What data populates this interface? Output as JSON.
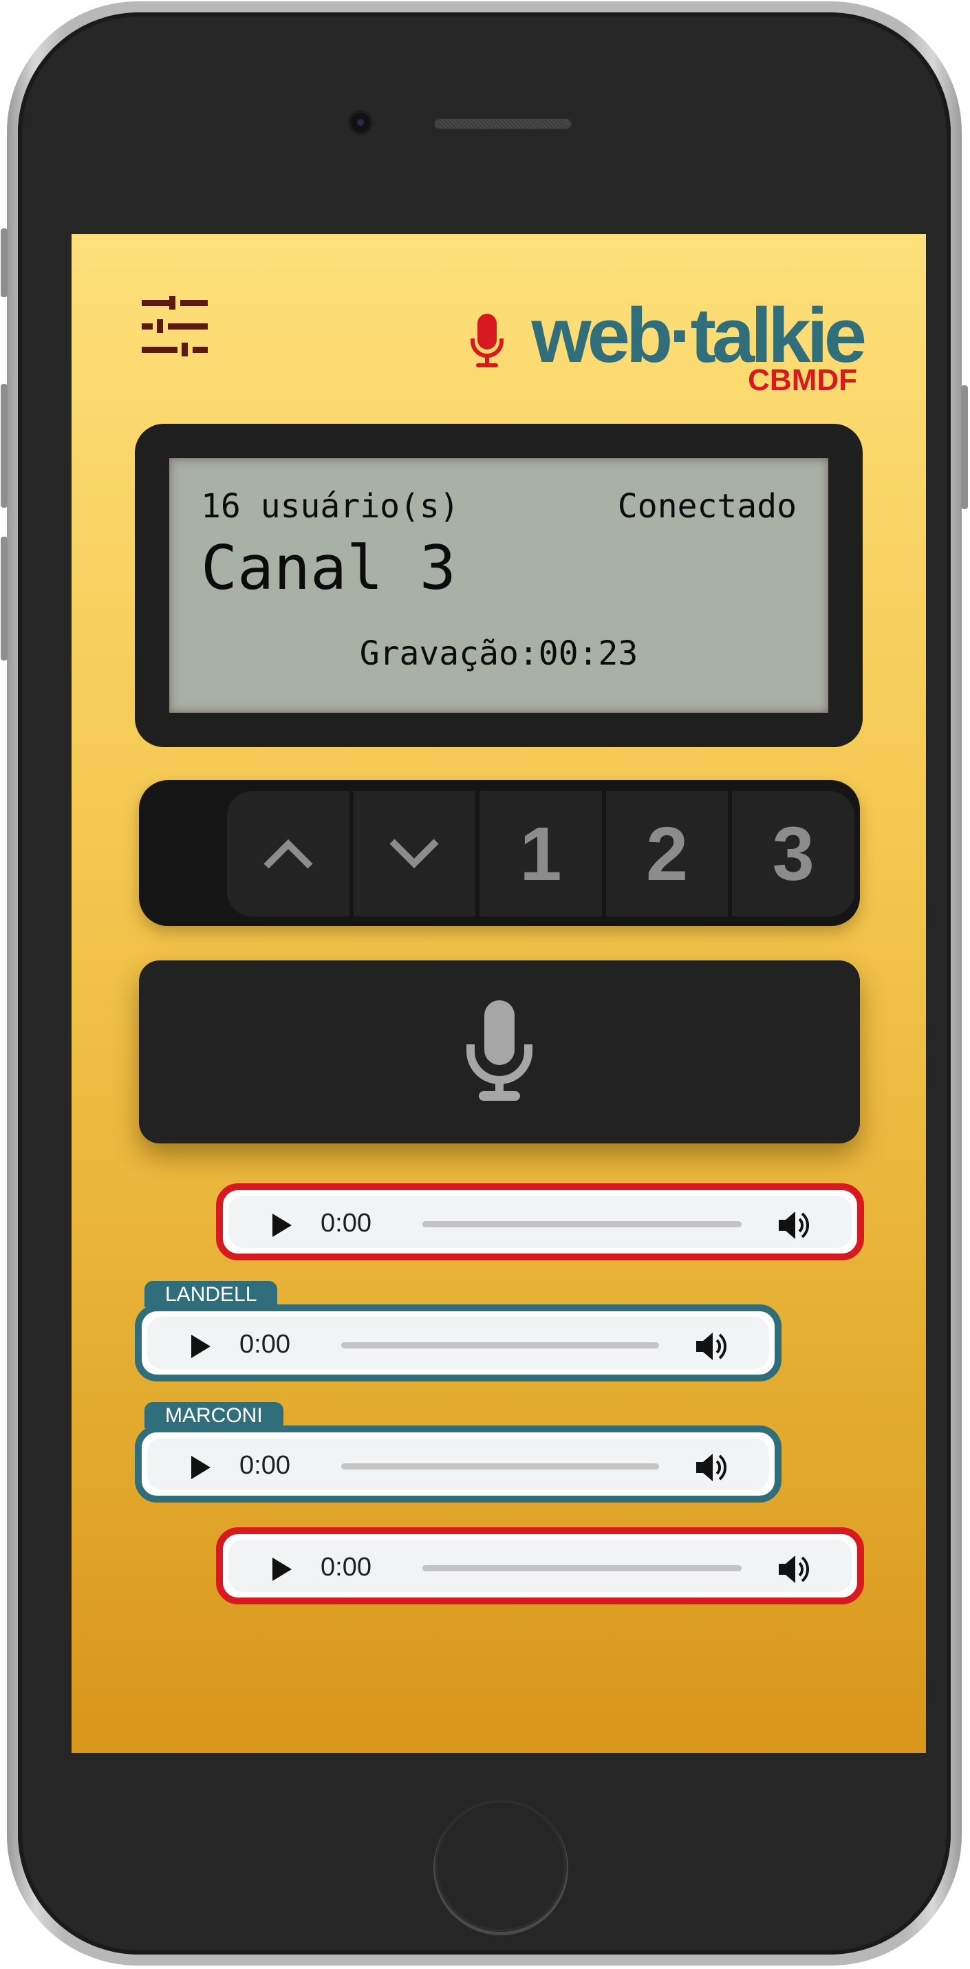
{
  "app": {
    "logo_text": "web·talkie",
    "logo_subtitle": "CBMDF",
    "brand_colors": {
      "teal": "#2f6e7a",
      "red": "#d71920",
      "yellow": "#f3c44b"
    }
  },
  "header": {
    "settings_icon": "sliders-icon"
  },
  "display": {
    "users": "16 usuário(s)",
    "status": "Conectado",
    "channel": "Canal 3",
    "recording": "Gravação:00:23"
  },
  "keypad": {
    "up_icon": "chevron-up-icon",
    "down_icon": "chevron-down-icon",
    "channels": [
      "1",
      "2",
      "3"
    ]
  },
  "ptt": {
    "icon": "microphone-icon"
  },
  "messages": [
    {
      "sender": "",
      "time": "0:00",
      "own": true
    },
    {
      "sender": "LANDELL",
      "time": "0:00",
      "own": false
    },
    {
      "sender": "MARCONI",
      "time": "0:00",
      "own": false
    },
    {
      "sender": "",
      "time": "0:00",
      "own": true
    }
  ]
}
